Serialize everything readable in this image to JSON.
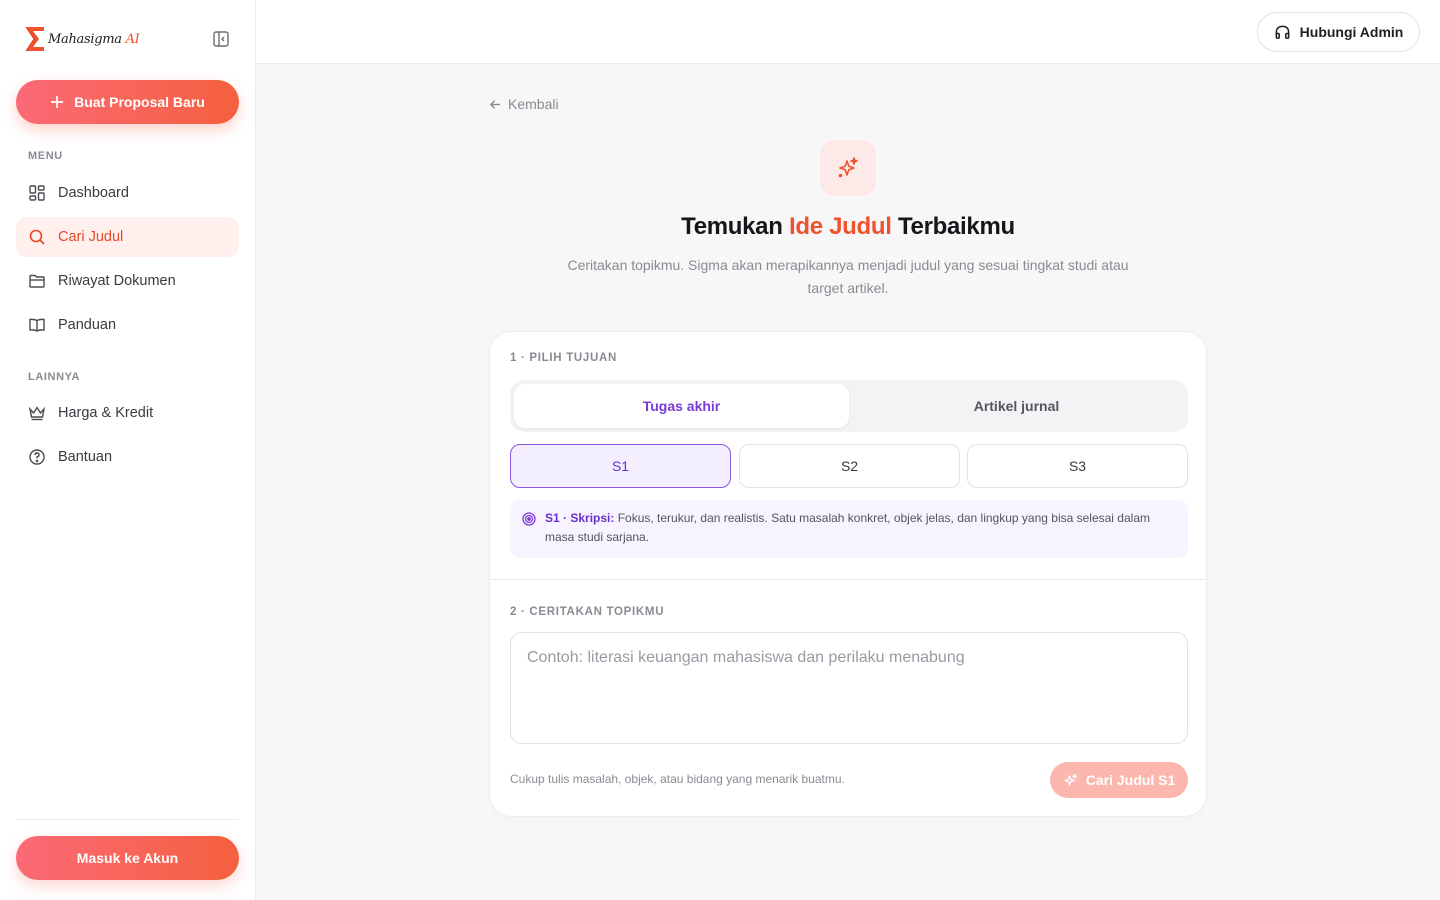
{
  "brand": {
    "name": "Mahasigma",
    "suffix": "AI",
    "accent": "#f0522e"
  },
  "sidebar": {
    "new_proposal_label": "Buat Proposal Baru",
    "menu_label": "MENU",
    "items": [
      {
        "label": "Dashboard",
        "icon": "grid-icon"
      },
      {
        "label": "Cari Judul",
        "icon": "search-icon",
        "active": true
      },
      {
        "label": "Riwayat Dokumen",
        "icon": "folder-icon"
      },
      {
        "label": "Panduan",
        "icon": "book-icon"
      }
    ],
    "other_label": "LAINNYA",
    "other_items": [
      {
        "label": "Harga & Kredit",
        "icon": "crown-icon"
      },
      {
        "label": "Bantuan",
        "icon": "help-circle-icon"
      }
    ],
    "login_label": "Masuk ke Akun"
  },
  "header": {
    "admin_label": "Hubungi Admin",
    "admin_icon": "headphones-icon"
  },
  "main": {
    "back_label": "Kembali",
    "title": {
      "before": "Temukan ",
      "accent": "Ide Judul",
      "after": " Terbaikmu"
    },
    "subtitle": "Ceritakan topikmu. Sigma akan merapikannya menjadi judul yang sesuai tingkat studi atau target artikel.",
    "step1_label": "1 · PILIH TUJUAN",
    "purpose_tabs": [
      {
        "label": "Tugas akhir",
        "selected": true
      },
      {
        "label": "Artikel jurnal",
        "selected": false
      }
    ],
    "levels": [
      {
        "label": "S1",
        "selected": true
      },
      {
        "label": "S2",
        "selected": false
      },
      {
        "label": "S3",
        "selected": false
      }
    ],
    "info_prefix": "S1 · Skripsi:",
    "info_text": " Fokus, terukur, dan realistis. Satu masalah konkret, objek jelas, dan lingkup yang bisa selesai dalam masa studi sarjana.",
    "step2_label": "2 · CERITAKAN TOPIKMU",
    "topic_value": "",
    "topic_placeholder": "Contoh: literasi keuangan mahasiswa dan perilaku menabung",
    "hint": "Cukup tulis masalah, objek, atau bidang yang menarik buatmu.",
    "submit_label": "Cari Judul S1"
  },
  "colors": {
    "primary": "#f5603f",
    "purple": "#7a3ad8",
    "muted": "#8a8a93"
  }
}
